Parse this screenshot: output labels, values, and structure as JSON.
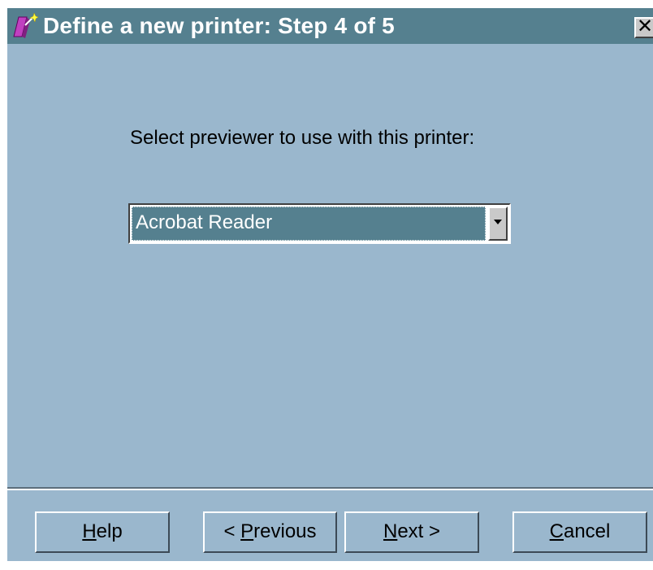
{
  "window": {
    "title": "Define a new printer: Step 4 of 5",
    "close_label": "✕",
    "icon": "printer-wizard-icon",
    "colors": {
      "titlebar": "#55808f",
      "background": "#9ab7cd",
      "selection": "#55808f"
    }
  },
  "content": {
    "prompt": "Select previewer to use with this printer:",
    "previewer": {
      "selected": "Acrobat Reader",
      "arrow_icon": "chevron-down-icon"
    }
  },
  "buttons": {
    "help": {
      "mnemonic": "H",
      "rest": "elp"
    },
    "previous": {
      "prefix": "< ",
      "mnemonic": "P",
      "rest": "revious"
    },
    "next": {
      "mnemonic": "N",
      "rest": "ext >"
    },
    "cancel": {
      "mnemonic": "C",
      "rest": "ancel"
    }
  }
}
